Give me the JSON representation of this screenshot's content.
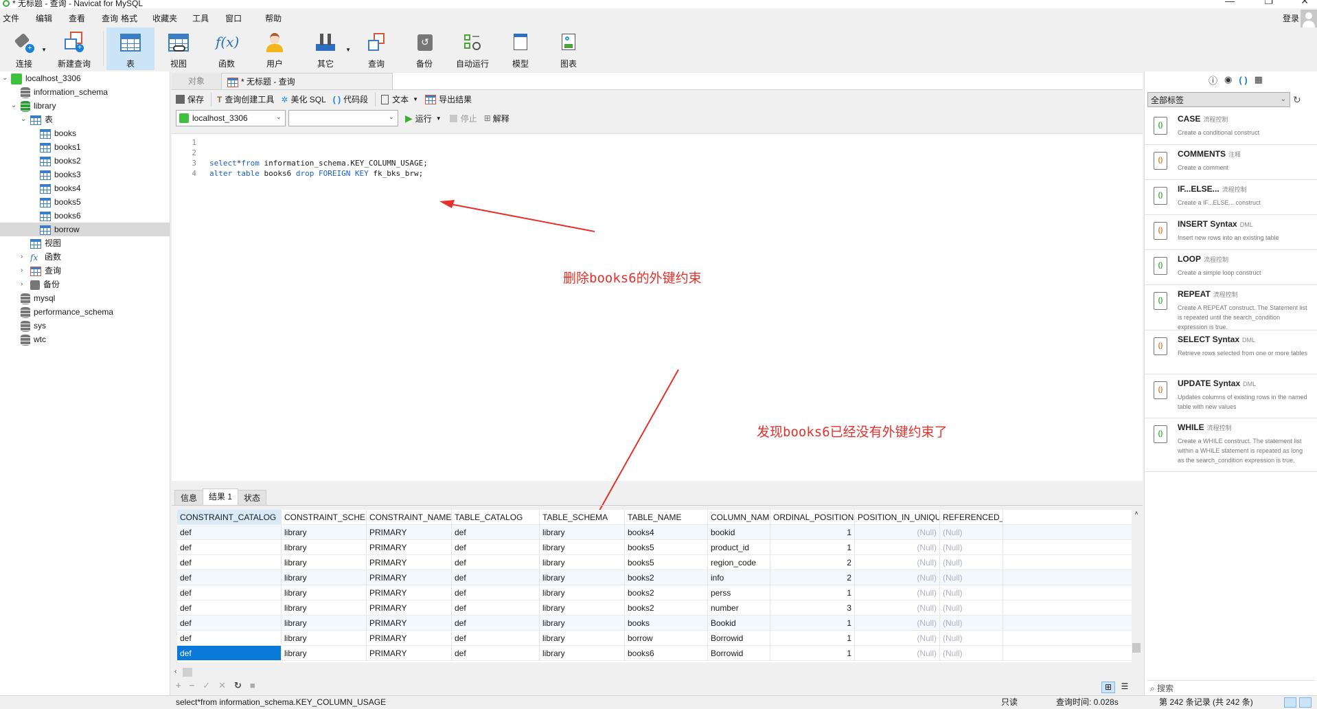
{
  "window": {
    "title": "* 无标题 - 查询 - Navicat for MySQL",
    "minimize": "—",
    "restore": "❐",
    "close": "✕"
  },
  "menu": [
    "文件",
    "编辑",
    "查看",
    "查询",
    "格式",
    "收藏夹",
    "工具",
    "窗口",
    "帮助"
  ],
  "login_label": "登录",
  "toolbar": [
    {
      "id": "connect",
      "label": "连接",
      "icon": "plug-icon"
    },
    {
      "id": "new-query",
      "label": "新建查询",
      "icon": "new-query-icon"
    },
    {
      "id": "table",
      "label": "表",
      "icon": "table-icon"
    },
    {
      "id": "view",
      "label": "视图",
      "icon": "view-icon"
    },
    {
      "id": "function",
      "label": "函数",
      "icon": "function-icon"
    },
    {
      "id": "user",
      "label": "用户",
      "icon": "user-icon"
    },
    {
      "id": "other",
      "label": "其它",
      "icon": "tools-icon"
    },
    {
      "id": "query",
      "label": "查询",
      "icon": "query-icon"
    },
    {
      "id": "backup",
      "label": "备份",
      "icon": "backup-icon"
    },
    {
      "id": "schedule",
      "label": "自动运行",
      "icon": "schedule-icon"
    },
    {
      "id": "model",
      "label": "模型",
      "icon": "model-icon"
    },
    {
      "id": "chart",
      "label": "图表",
      "icon": "chart-icon"
    }
  ],
  "tree": {
    "connection": "localhost_3306",
    "databases": [
      "information_schema",
      "library",
      "mysql",
      "performance_schema",
      "sys",
      "wtc"
    ],
    "library_tables_label": "表",
    "tables": [
      "books",
      "books1",
      "books2",
      "books3",
      "books4",
      "books5",
      "books6",
      "borrow"
    ],
    "selected_table": "borrow",
    "library_other": [
      "视图",
      "函数",
      "查询",
      "备份"
    ]
  },
  "tabs": {
    "objects": "对象",
    "query": "* 无标题 - 查询"
  },
  "query_toolbar": {
    "save": "保存",
    "builder": "查询创建工具",
    "beautify": "美化 SQL",
    "snippet": "代码段",
    "text": "文本",
    "export": "导出结果"
  },
  "run_bar": {
    "connection": "localhost_3306",
    "database": "",
    "run": "运行",
    "stop": "停止",
    "explain": "解释"
  },
  "editor": {
    "line_numbers": [
      "1",
      "2",
      "3",
      "4"
    ],
    "lines": [
      "",
      "",
      "select*from information_schema.KEY_COLUMN_USAGE;",
      "alter table books6 drop FOREIGN KEY fk_bks_brw;"
    ]
  },
  "annotations": {
    "first": "删除books6的外键约束",
    "second": "发现books6已经没有外键约束了",
    "color": "#e8302a"
  },
  "result_tabs": [
    "信息",
    "结果 1",
    "状态"
  ],
  "grid": {
    "columns": [
      "CONSTRAINT_CATALOG",
      "CONSTRAINT_SCHEMA",
      "CONSTRAINT_NAME",
      "TABLE_CATALOG",
      "TABLE_SCHEMA",
      "TABLE_NAME",
      "COLUMN_NAME",
      "ORDINAL_POSITION",
      "POSITION_IN_UNIQUE_C",
      "REFERENCED_T"
    ],
    "rows": [
      [
        "def",
        "library",
        "PRIMARY",
        "def",
        "library",
        "books4",
        "bookid",
        "1",
        "(Null)",
        "(Null)"
      ],
      [
        "def",
        "library",
        "PRIMARY",
        "def",
        "library",
        "books5",
        "product_id",
        "1",
        "(Null)",
        "(Null)"
      ],
      [
        "def",
        "library",
        "PRIMARY",
        "def",
        "library",
        "books5",
        "region_code",
        "2",
        "(Null)",
        "(Null)"
      ],
      [
        "def",
        "library",
        "PRIMARY",
        "def",
        "library",
        "books2",
        "info",
        "2",
        "(Null)",
        "(Null)"
      ],
      [
        "def",
        "library",
        "PRIMARY",
        "def",
        "library",
        "books2",
        "perss",
        "1",
        "(Null)",
        "(Null)"
      ],
      [
        "def",
        "library",
        "PRIMARY",
        "def",
        "library",
        "books2",
        "number",
        "3",
        "(Null)",
        "(Null)"
      ],
      [
        "def",
        "library",
        "PRIMARY",
        "def",
        "library",
        "books",
        "Bookid",
        "1",
        "(Null)",
        "(Null)"
      ],
      [
        "def",
        "library",
        "PRIMARY",
        "def",
        "library",
        "borrow",
        "Borrowid",
        "1",
        "(Null)",
        "(Null)"
      ],
      [
        "def",
        "library",
        "PRIMARY",
        "def",
        "library",
        "books6",
        "Borrowid",
        "1",
        "(Null)",
        "(Null)"
      ]
    ]
  },
  "status": {
    "sql": "select*from information_schema.KEY_COLUMN_USAGE",
    "mode": "只读",
    "time": "查询时间: 0.028s",
    "records": "第 242 条记录 (共 242 条)"
  },
  "snippets": {
    "filter": "全部标签",
    "search_placeholder": "搜索",
    "items": [
      {
        "title": "CASE",
        "tag": "流程控制",
        "desc": "Create a conditional construct",
        "kind": "flow"
      },
      {
        "title": "COMMENTS",
        "tag": "注释",
        "desc": "Create a comment",
        "kind": "dml"
      },
      {
        "title": "IF...ELSE...",
        "tag": "流程控制",
        "desc": "Create a IF...ELSE... construct",
        "kind": "flow"
      },
      {
        "title": "INSERT Syntax",
        "tag": "DML",
        "desc": "Insert new rows into an existing table",
        "kind": "dml"
      },
      {
        "title": "LOOP",
        "tag": "流程控制",
        "desc": "Create a simple loop construct",
        "kind": "flow"
      },
      {
        "title": "REPEAT",
        "tag": "流程控制",
        "desc": "Create A REPEAT construct. The Statement list is repeated until the search_condition expression is true.",
        "kind": "flow"
      },
      {
        "title": "SELECT Syntax",
        "tag": "DML",
        "desc": "Retrieve rows selected from one or more tables",
        "kind": "dml"
      },
      {
        "title": "UPDATE Syntax",
        "tag": "DML",
        "desc": "Updates columns of existing rows in the named table with new values",
        "kind": "dml"
      },
      {
        "title": "WHILE",
        "tag": "流程控制",
        "desc": "Create a WHILE construct. The statement list within a WHILE statement is repeated as long as the search_condition expression is true.",
        "kind": "flow"
      }
    ]
  }
}
